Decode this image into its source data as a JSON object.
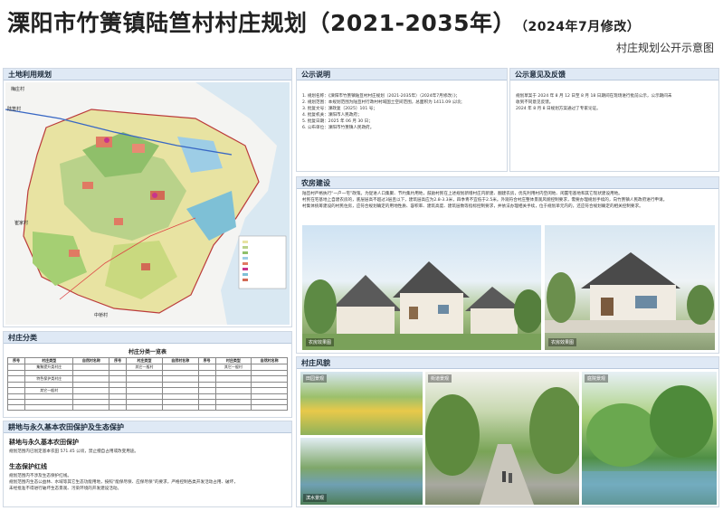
{
  "header": {
    "title": "溧阳市竹箦镇陆笪村村庄规划（2021-2035年）",
    "modified": "（2024年7月修改）",
    "subtitle": "村庄规划公开示意图"
  },
  "panels": {
    "land_use": "土地利用规划",
    "notice": "公示说明",
    "feedback": "公示意见及反馈",
    "housing": "农房建设",
    "classification": "村庄分类",
    "farmland": "耕地与永久基本农田保护及生态保护",
    "scenery": "村庄风貌"
  },
  "map_labels": {
    "north": "梅庄村",
    "west": "陆笪村",
    "southwest": "崔家村",
    "south": "中桥村"
  },
  "notice_lines": [
    "1. 规划名称：《溧阳市竹箦镇陆笪村村庄规划（2021-2035年）（2024年7月修改）》；",
    "2. 规划范围：本规划范围为陆笪村行政村村域国土空间范围，总面积为 1411.09 公顷；",
    "3. 批复文号：溧政复〔2025〕101 号；",
    "4. 批复机关：溧阳市人民政府；",
    "5. 批复日期：2025 年 06 月 30 日；",
    "6. 公布单位：溧阳市竹箦镇人民政府。"
  ],
  "feedback_lines": [
    "规划草案于 2024 年 8 月 12 日至 8 月 18 日期间在现场进行批前公示，公示期间未",
    "收到不同意见反馈。",
    "2024 年 8 月 8 日规划方案通过了专家论证。"
  ],
  "housing_lines": [
    "陆笪村严格执行“一户一宅”政策。为促进人口集聚、节约集约用地，鼓励村民在上述规划新增村庄内新建、翻建农房，优先利用村内空闲地、闲置宅基地和其它现状建设用地。",
    "村民在宅基地上自建农房的，底层层高不超过3层且以下，建筑层高应为2.8-3.3米，四季青不宜低于2.5米。外观符合村庄整体景观风貌控制要求，需要办理规划手续的，向竹箦镇人民政府进行申请。",
    "村集体统筹建设的村民住房，应符合规划确定的用地性质、容积率、建筑高度、建筑层数等指标控制要求，并依法办理相关手续，位于规划单元内的，还应符合规划确定的相关控制要求。"
  ],
  "housing_captions": [
    "农房效果图",
    "农房效果图"
  ],
  "classification_table_title": "村庄分类一览表",
  "classification_headers": [
    "序号",
    "村庄类型",
    "自然村名称",
    "序号",
    "村庄类型",
    "自然村名称",
    "序号",
    "村庄类型",
    "自然村名称"
  ],
  "village_types": [
    "集聚提升类村庄",
    "特色保护类村庄",
    "其它一般村"
  ],
  "farmland_heading": "耕地与永久基本农田保护",
  "farmland_text": "规划范围内已划定基本农田 571.45 公顷，禁止擅自占用或改变用途。",
  "eco_heading": "生态保护红线",
  "eco_lines": [
    "规划范围内不涉及生态保护红线。",
    "规划范围内生态公益林、水域等其它生态功能用地，按照“能保尽保、应保尽保”的要求，严格控制各类开发活动占用、破坏，",
    "未经批准不得进行破坏生态景观、污染环境的开发建设活动。"
  ],
  "scenery_captions": [
    "田园景观",
    "街道景观",
    "滨水景观",
    "庭院景观"
  ]
}
